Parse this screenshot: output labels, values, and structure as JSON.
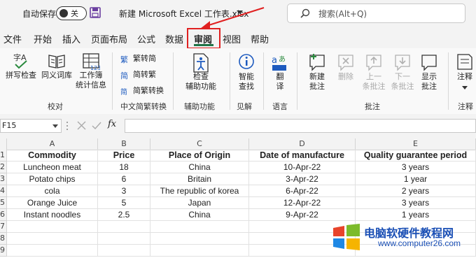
{
  "titlebar": {
    "autosave_label": "自动保存",
    "toggle_state": "关",
    "filename": "新建 Microsoft Excel 工作表.xlsx",
    "search_placeholder": "搜索(Alt+Q)"
  },
  "menu": {
    "items": [
      "文件",
      "开始",
      "插入",
      "页面布局",
      "公式",
      "数据",
      "审阅",
      "视图",
      "帮助"
    ],
    "active": "审阅"
  },
  "ribbon": {
    "groups": [
      {
        "label": "校对",
        "buttons": [
          "拼写检查",
          "同义词库",
          "工作簿\n统计信息"
        ]
      },
      {
        "label": "中文简繁转换",
        "buttons": [
          "繁转简",
          "简转繁",
          "简繁转换"
        ]
      },
      {
        "label": "辅助功能",
        "buttons": [
          "检查\n辅助功能"
        ]
      },
      {
        "label": "见解",
        "buttons": [
          "智能\n查找"
        ]
      },
      {
        "label": "语言",
        "buttons": [
          "翻\n译"
        ]
      },
      {
        "label": "批注",
        "buttons": [
          "新建\n批注",
          "删除",
          "上一\n条批注",
          "下一\n条批注",
          "显示\n批注"
        ]
      },
      {
        "label": "注释",
        "buttons": [
          "注释"
        ]
      }
    ]
  },
  "formula_bar": {
    "name_box": "F15",
    "fx": "fx"
  },
  "sheet": {
    "columns": [
      "A",
      "B",
      "C",
      "D",
      "E"
    ],
    "rows": [
      "1",
      "2",
      "3",
      "4",
      "5",
      "6",
      "7",
      "8",
      "9"
    ],
    "table": [
      [
        "Commodity",
        "Price",
        "Place of Origin",
        "Date of manufacture",
        "Quality guarantee period"
      ],
      [
        "Luncheon meat",
        "18",
        "China",
        "10-Apr-22",
        "3 years"
      ],
      [
        "Potato chips",
        "6",
        "Britain",
        "3-Apr-22",
        "1  year"
      ],
      [
        "cola",
        "3",
        "The republic of korea",
        "6-Apr-22",
        "2  years"
      ],
      [
        "Orange Juice",
        "5",
        "Japan",
        "12-Apr-22",
        "3 years"
      ],
      [
        "Instant noodles",
        "2.5",
        "China",
        "9-Apr-22",
        "1 years"
      ]
    ]
  },
  "watermark": {
    "name": "电脑软硬件教程网",
    "url": "www.computer26.com"
  },
  "colors": {
    "excel_green": "#217346",
    "highlight_red": "#e02020",
    "watermark_blue": "#1a4fb5"
  }
}
